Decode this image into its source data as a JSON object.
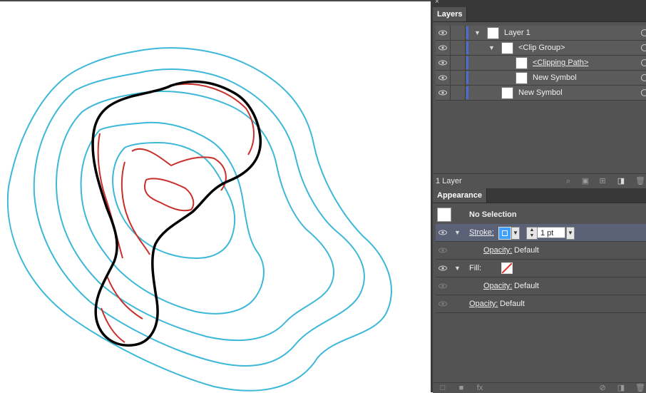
{
  "layers_panel": {
    "close_glyph": "×",
    "tab_label": "Layers",
    "rows": [
      {
        "label": "Layer 1",
        "expanded": true
      },
      {
        "label": "<Clip Group>",
        "expanded": true
      },
      {
        "label": "<Clipping Path>",
        "expanded": false
      },
      {
        "label": "New Symbol",
        "expanded": false
      },
      {
        "label": "New Symbol",
        "expanded": false
      }
    ],
    "footer_label": "1 Layer",
    "layer_color": "#4a6bd8"
  },
  "appearance_panel": {
    "tab_label": "Appearance",
    "selection_label": "No Selection",
    "stroke_label": "Stroke:",
    "stroke_weight": "1 pt",
    "stroke_opacity_label": "Opacity:",
    "stroke_opacity_value": "Default",
    "fill_label": "Fill:",
    "fill_opacity_label": "Opacity:",
    "fill_opacity_value": "Default",
    "object_opacity_label": "Opacity:",
    "object_opacity_value": "Default"
  },
  "artwork": {
    "contour_color": "#3db8d8",
    "clipped_color": "#c8302b",
    "clip_path_color": "#000000"
  }
}
